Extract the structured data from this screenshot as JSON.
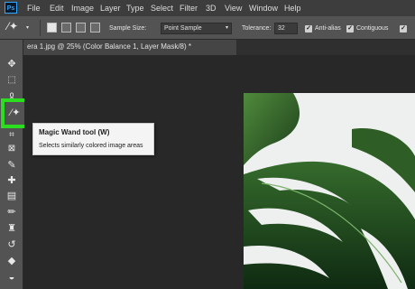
{
  "app": {
    "logo": "Ps",
    "accent": "#31a8ff"
  },
  "menu": [
    "File",
    "Edit",
    "Image",
    "Layer",
    "Type",
    "Select",
    "Filter",
    "3D",
    "View",
    "Window",
    "Help"
  ],
  "options": {
    "sample_size_label": "Sample Size:",
    "sample_size_value": "Point Sample",
    "tolerance_label": "Tolerance:",
    "tolerance_value": "32",
    "anti_alias_label": "Anti-alias",
    "contiguous_label": "Contiguous",
    "anti_alias_checked": true,
    "contiguous_checked": true
  },
  "document_tab": {
    "title": "era 1.jpg @ 25% (Color Balance 1, Layer Mask/8) *",
    "close": "×"
  },
  "tooltip": {
    "title": "Magic Wand tool (W)",
    "description": "Selects similarly colored image areas"
  },
  "toolbar": [
    "move-tool",
    "marquee-tool",
    "lasso-tool",
    "magic-wand-tool",
    "crop-tool",
    "frame-tool",
    "eyedropper-tool",
    "healing-brush-tool",
    "brush-tool",
    "clone-stamp-tool",
    "history-brush-tool",
    "eraser-tool",
    "paint-bucket-tool"
  ],
  "colors": {
    "highlight": "#2bdf1e",
    "toolbar_bg": "#535353",
    "canvas_bg": "#282828"
  }
}
